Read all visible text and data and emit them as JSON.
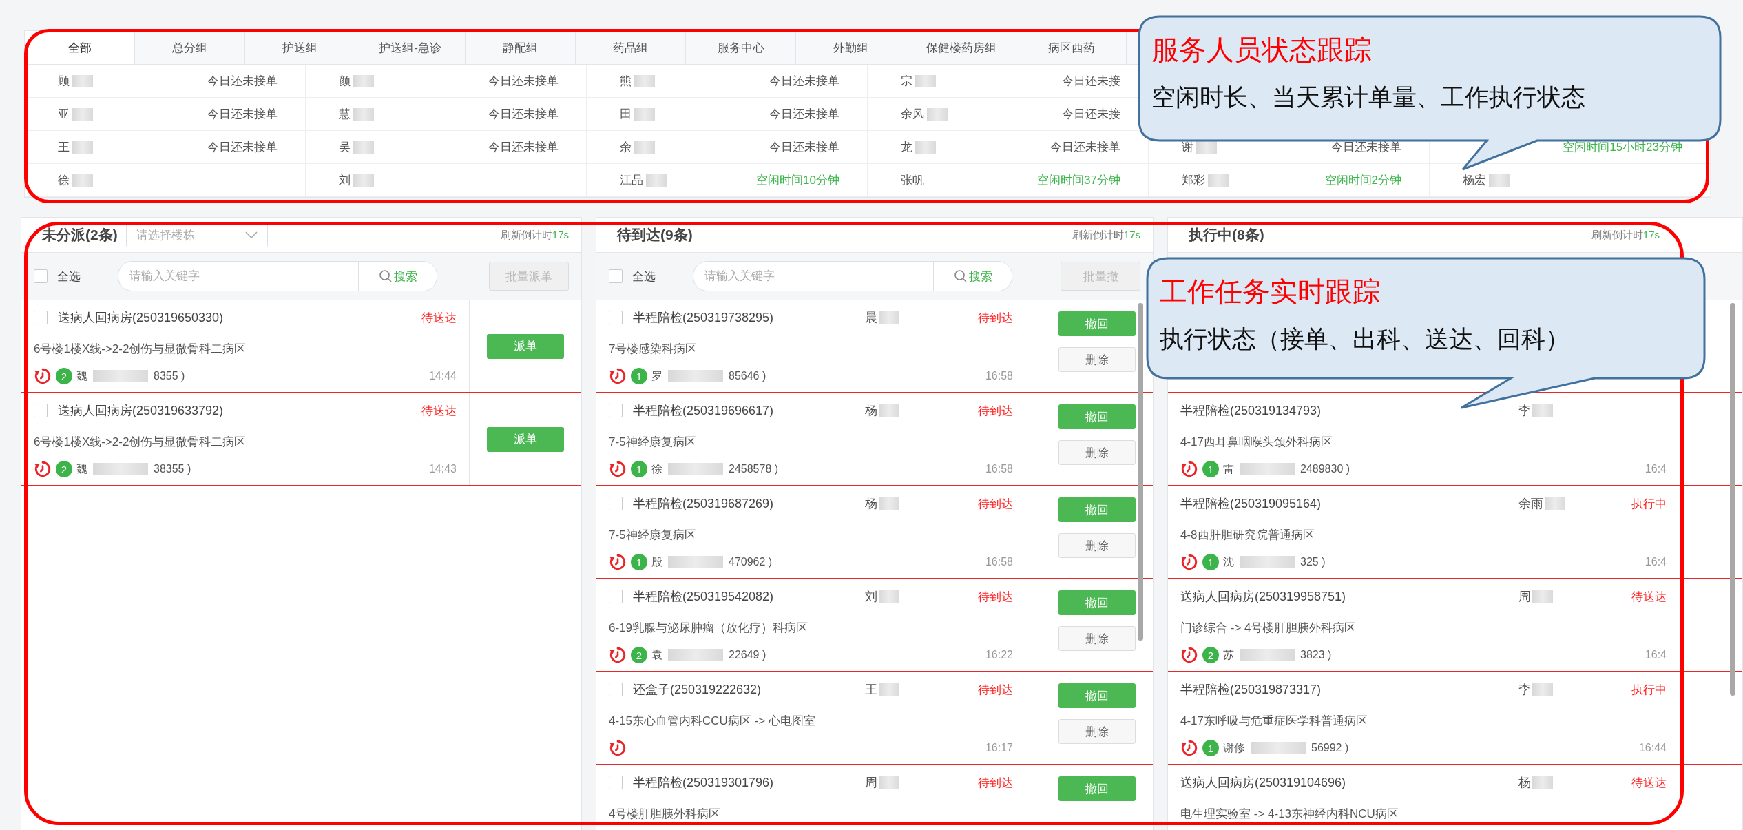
{
  "staff": {
    "tabs": [
      {
        "label": "全部",
        "selected": true
      },
      {
        "label": "总分组",
        "selected": false
      },
      {
        "label": "护送组",
        "selected": false
      },
      {
        "label": "护送组-急诊",
        "selected": false
      },
      {
        "label": "静配组",
        "selected": false
      },
      {
        "label": "药品组",
        "selected": false
      },
      {
        "label": "服务中心",
        "selected": false
      },
      {
        "label": "外勤组",
        "selected": false
      },
      {
        "label": "保健楼药房组",
        "selected": false
      },
      {
        "label": "病区西药",
        "selected": false
      }
    ],
    "rows": [
      {
        "cells": [
          {
            "name": "顾",
            "blurred": true,
            "status": "今日还未接单",
            "kind": "pending"
          },
          {
            "name": "颜",
            "blurred": true,
            "status": "今日还未接单",
            "kind": "pending"
          },
          {
            "name": "熊",
            "blurred": true,
            "status": "今日还未接单",
            "kind": "pending"
          },
          {
            "name": "宗",
            "blurred": true,
            "status": "今日还未接",
            "kind": "pending"
          },
          {},
          {}
        ]
      },
      {
        "cells": [
          {
            "name": "亚",
            "blurred": true,
            "status": "今日还未接单",
            "kind": "pending"
          },
          {
            "name": "慧",
            "blurred": true,
            "status": "今日还未接单",
            "kind": "pending"
          },
          {
            "name": "田",
            "blurred": true,
            "status": "今日还未接单",
            "kind": "pending"
          },
          {
            "name": "余风",
            "blurred": true,
            "status": "今日还未接",
            "kind": "pending"
          },
          {},
          {}
        ]
      },
      {
        "cells": [
          {
            "name": "王",
            "blurred": true,
            "status": "今日还未接单",
            "kind": "pending"
          },
          {
            "name": "吴",
            "blurred": true,
            "status": "今日还未接单",
            "kind": "pending"
          },
          {
            "name": "余",
            "blurred": true,
            "status": "今日还未接单",
            "kind": "pending"
          },
          {
            "name": "龙",
            "blurred": true,
            "status": "今日还未接单",
            "kind": "pending"
          },
          {
            "name": "谢",
            "blurred": true,
            "status": "今日还未接单",
            "kind": "pending"
          },
          {
            "status": "空闲时间15小时23分钟",
            "kind": "idle"
          }
        ]
      },
      {
        "cells": [
          {
            "name": "徐",
            "blurred": true
          },
          {
            "name": "刘",
            "blurred": true
          },
          {
            "name": "江品",
            "blurred": true,
            "status": "空闲时间10分钟",
            "kind": "idle"
          },
          {
            "name": "张帆",
            "blurred": false,
            "status": "空闲时间37分钟",
            "kind": "idle"
          },
          {
            "name": "郑彩",
            "blurred": true,
            "status": "空闲时间2分钟",
            "kind": "idle"
          },
          {
            "name": "杨宏",
            "blurred": true
          }
        ]
      }
    ]
  },
  "panels": [
    {
      "title": "未分派(2条)",
      "building_select": {
        "placeholder": "请选择楼栋"
      },
      "countdown_label": "刷新倒计时",
      "countdown_value": "17s",
      "toolbar": {
        "select_all": "全选",
        "checked": false,
        "search_placeholder": "请输入关键字",
        "search_button": "搜索",
        "batch_button": {
          "label": "批量派单",
          "disabled": true
        }
      },
      "cards": [
        {
          "checked": false,
          "title": "送病人回病房(250319650330)",
          "status": "待送达",
          "address": "6号楼1楼X线->2-2创伤与显微骨科二病区",
          "badge": "2",
          "contact_start": "魏",
          "contact_end": "8355 )",
          "time": "14:44",
          "buttons": [
            {
              "label": "派单",
              "kind": "primary"
            }
          ]
        },
        {
          "checked": false,
          "title": "送病人回病房(250319633792)",
          "status": "待送达",
          "address": "6号楼1楼X线->2-2创伤与显微骨科二病区",
          "badge": "2",
          "contact_start": "魏",
          "contact_end": "38355 )",
          "time": "14:43",
          "buttons": [
            {
              "label": "派单",
              "kind": "primary"
            }
          ]
        }
      ]
    },
    {
      "title": "待到达(9条)",
      "countdown_label": "刷新倒计时",
      "countdown_value": "17s",
      "scrollbar": true,
      "toolbar": {
        "select_all": "全选",
        "checked": false,
        "search_placeholder": "请输入关键字",
        "search_button": "搜索",
        "batch_button": {
          "label": "批量撤",
          "disabled": true
        }
      },
      "cards": [
        {
          "checked": false,
          "title": "半程陪检(250319738295)",
          "person": "晨",
          "status": "待到达",
          "address": "7号楼感染科病区",
          "badge": "1",
          "contact_start": "罗",
          "contact_end": "85646 )",
          "time": "16:58",
          "buttons": [
            {
              "label": "撤回",
              "kind": "primary"
            },
            {
              "label": "删除",
              "kind": "default"
            }
          ]
        },
        {
          "checked": false,
          "title": "半程陪检(250319696617)",
          "person": "杨",
          "status": "待到达",
          "address": "7-5神经康复病区",
          "badge": "1",
          "contact_start": "徐",
          "contact_end": "2458578 )",
          "time": "16:58",
          "buttons": [
            {
              "label": "撤回",
              "kind": "primary"
            },
            {
              "label": "删除",
              "kind": "default"
            }
          ]
        },
        {
          "checked": false,
          "title": "半程陪检(250319687269)",
          "person": "杨",
          "status": "待到达",
          "address": "7-5神经康复病区",
          "badge": "1",
          "contact_start": "殷",
          "contact_end": "470962 )",
          "time": "16:58",
          "buttons": [
            {
              "label": "撤回",
              "kind": "primary"
            },
            {
              "label": "删除",
              "kind": "default"
            }
          ]
        },
        {
          "checked": false,
          "title": "半程陪检(250319542082)",
          "person": "刘",
          "status": "待到达",
          "address": "6-19乳腺与泌尿肿瘤（放化疗）科病区",
          "badge": "2",
          "contact_start": "袁",
          "contact_end": "22649 )",
          "time": "16:22",
          "buttons": [
            {
              "label": "撤回",
              "kind": "primary"
            },
            {
              "label": "删除",
              "kind": "default"
            }
          ]
        },
        {
          "checked": false,
          "title": "还盒子(250319222632)",
          "person": "王",
          "status": "待到达",
          "address": "4-15东心血管内科CCU病区 -> 心电图室",
          "time": "16:17",
          "buttons": [
            {
              "label": "撤回",
              "kind": "primary"
            },
            {
              "label": "删除",
              "kind": "default"
            }
          ]
        },
        {
          "checked": false,
          "title": "半程陪检(250319301796)",
          "person": "周",
          "status": "待到达",
          "address": "4号楼肝胆胰外科病区",
          "buttons": [
            {
              "label": "撤回",
              "kind": "primary"
            }
          ]
        }
      ]
    },
    {
      "title": "执行中(8条)",
      "countdown_label": "刷新倒计时",
      "countdown_value": "17s",
      "scrollbar": true,
      "cards": [
        {
          "title": "半程陪检(250319134793)",
          "person": "李",
          "address": "4-17西耳鼻咽喉头颈外科病区",
          "badge": "1",
          "contact_start": "雷",
          "contact_end": "2489830 )",
          "time": "16:4"
        },
        {
          "title": "半程陪检(250319095164)",
          "person": "余雨",
          "status": "执行中",
          "address": "4-8西肝胆研究院普通病区",
          "badge": "1",
          "contact_start": "沈",
          "contact_end": "325 )",
          "time": "16:4"
        },
        {
          "title": "送病人回病房(250319958751)",
          "person": "周",
          "status": "待送达",
          "address": "门诊综合 -> 4号楼肝胆胰外科病区",
          "badge": "2",
          "contact_start": "苏",
          "contact_end": "3823 )",
          "time": "16:4"
        },
        {
          "title": "半程陪检(250319873317)",
          "person": "李",
          "status": "执行中",
          "address": "4-17东呼吸与危重症医学科普通病区",
          "badge": "1",
          "contact_start": "谢修",
          "contact_end": "56992 )",
          "time": "16:44"
        },
        {
          "title": "送病人回病房(250319104696)",
          "person": "杨",
          "status": "待送达",
          "address": "电生理实验室 -> 4-13东神经内科NCU病区"
        }
      ]
    }
  ],
  "callouts": [
    {
      "title": "服务人员状态跟踪",
      "text": "空闲时长、当天累计单量、工作执行状态"
    },
    {
      "title": "工作任务实时跟踪",
      "text": "执行状态（接单、出科、送达、回科）"
    }
  ]
}
